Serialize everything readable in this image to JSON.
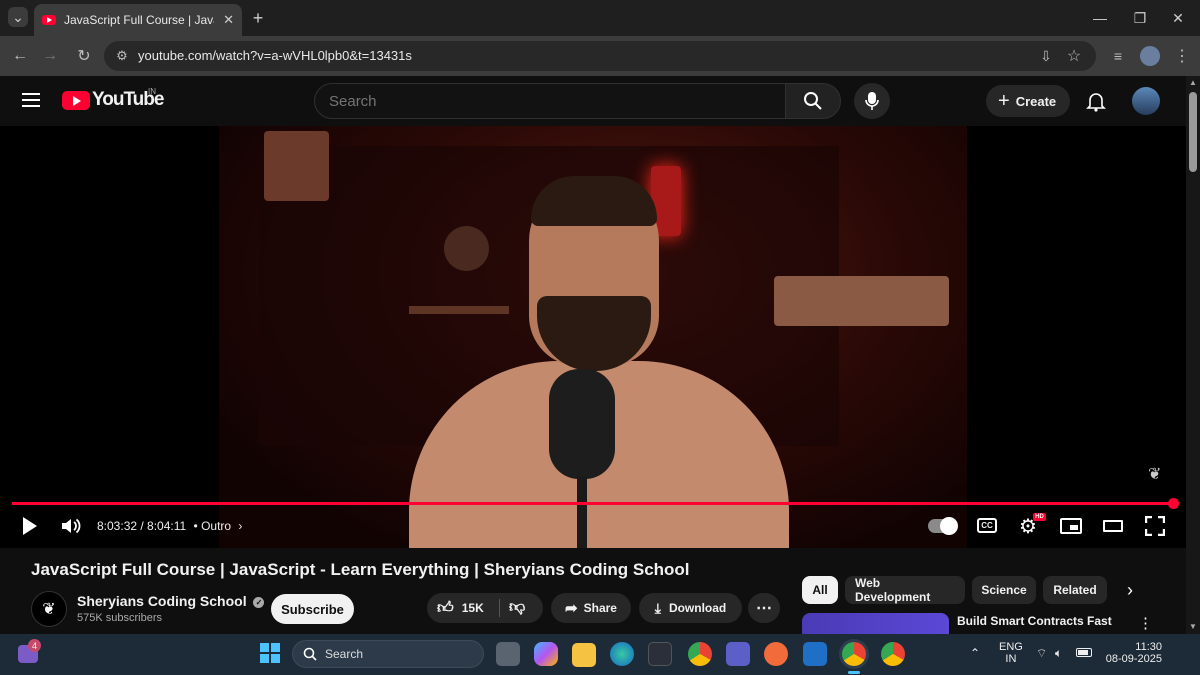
{
  "browser": {
    "tab_title": "JavaScript Full Course | JavaScript - Learn Everything | Sheryians Coding School",
    "tab_close": "✕",
    "new_tab": "+",
    "url": "youtube.com/watch?v=a-wVHL0lpb0&t=13431s"
  },
  "youtube": {
    "logo_text": "YouTube",
    "region": "IN",
    "search_placeholder": "Search",
    "create_label": "Create"
  },
  "player": {
    "time": "8:03:32 / 8:04:11",
    "chapter": "• Outro",
    "progress": 0.998,
    "hd_badge": "HD"
  },
  "video": {
    "title": "JavaScript Full Course | JavaScript - Learn Everything | Sheryians Coding School",
    "channel": "Sheryians Coding School",
    "subscribers": "575K subscribers",
    "subscribe_label": "Subscribe",
    "likes": "15K",
    "share_label": "Share",
    "download_label": "Download"
  },
  "chips": [
    "All",
    "Web Development",
    "Science",
    "Related"
  ],
  "recommendation": {
    "title": "Build Smart Contracts Fast"
  },
  "taskbar": {
    "search_label": "Search",
    "teams_badge": "4",
    "lang_1": "ENG",
    "lang_2": "IN",
    "time": "11:30",
    "date": "08-09-2025"
  },
  "colors": {
    "accent": "#ff0033",
    "bg": "#0f0f0f",
    "taskbar": "#1d2a37"
  }
}
